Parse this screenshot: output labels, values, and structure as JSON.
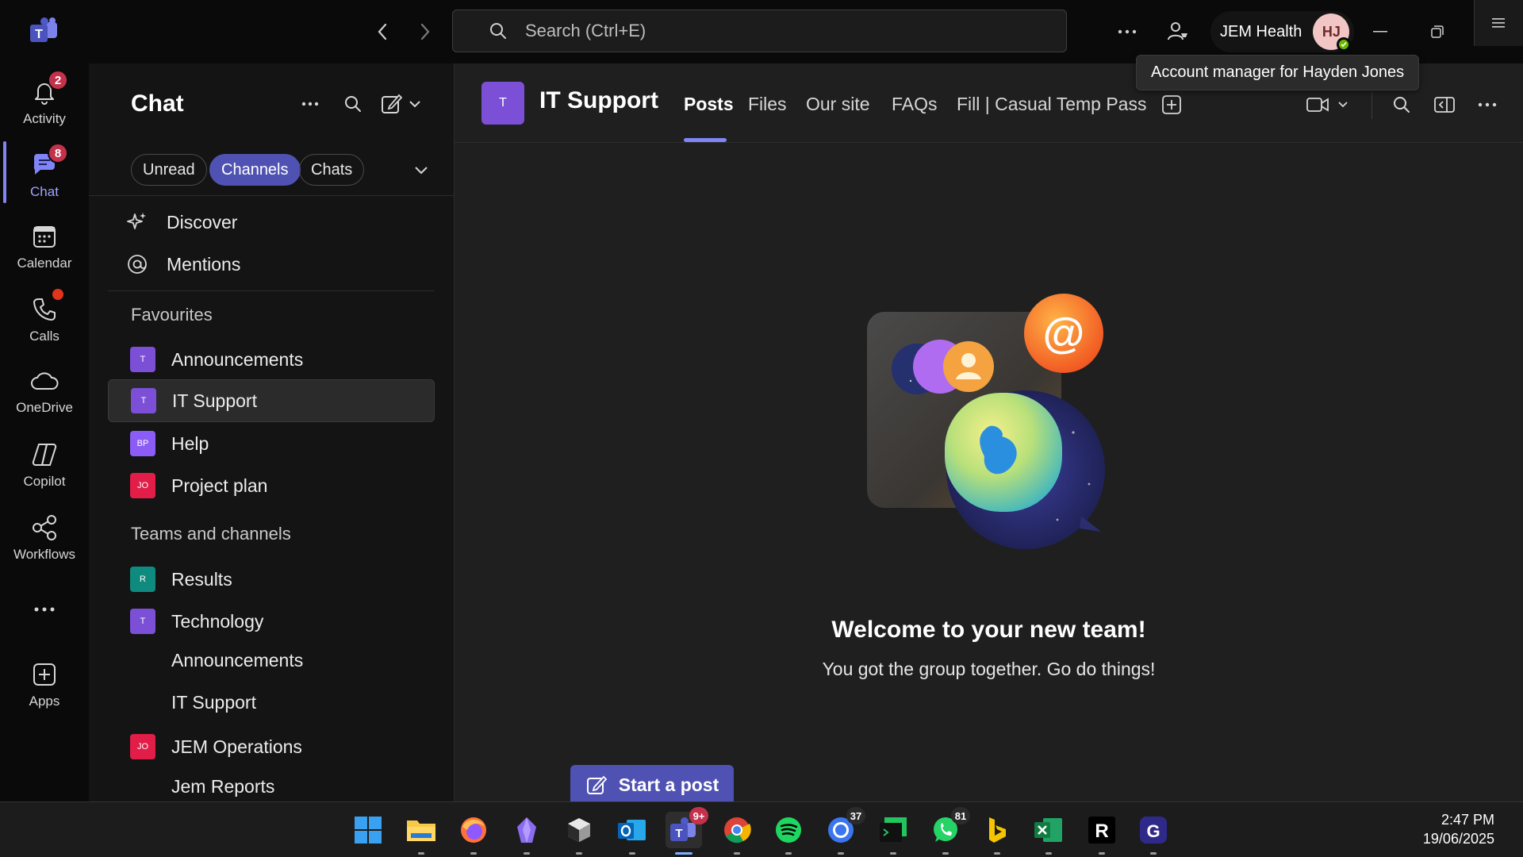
{
  "titlebar": {
    "search_placeholder": "Search (Ctrl+E)",
    "org_name": "JEM Health",
    "avatar_initials": "HJ",
    "tooltip": "Account manager for Hayden Jones"
  },
  "rail": {
    "items": [
      {
        "label": "Activity",
        "badge": "2"
      },
      {
        "label": "Chat",
        "badge": "8"
      },
      {
        "label": "Calendar"
      },
      {
        "label": "Calls"
      },
      {
        "label": "OneDrive"
      },
      {
        "label": "Copilot"
      },
      {
        "label": "Workflows"
      },
      {
        "label": "Apps"
      }
    ]
  },
  "chat": {
    "title": "Chat",
    "filters": [
      "Unread",
      "Channels",
      "Chats"
    ],
    "active_filter": "Channels",
    "nav": [
      "Discover",
      "Mentions"
    ],
    "favourites_label": "Favourites",
    "favourites": [
      {
        "tile": "T",
        "label": "Announcements",
        "color": "#7b4fd6"
      },
      {
        "tile": "T",
        "label": "IT Support",
        "color": "#7b4fd6"
      },
      {
        "tile": "BP",
        "label": "Help",
        "color": "#8b5cf6"
      },
      {
        "tile": "JO",
        "label": "Project plan",
        "color": "#e11d48"
      }
    ],
    "teams_label": "Teams and channels",
    "teams": [
      {
        "tile": "R",
        "label": "Results",
        "color": "#0f8a7e"
      },
      {
        "tile": "T",
        "label": "Technology",
        "color": "#7b4fd6"
      },
      {
        "label": "Announcements"
      },
      {
        "label": "IT Support"
      },
      {
        "tile": "JO",
        "label": "JEM Operations",
        "color": "#e11d48"
      },
      {
        "label": "Jem Reports"
      }
    ]
  },
  "main": {
    "team_tile": "T",
    "team_name": "IT Support",
    "tabs": [
      "Posts",
      "Files",
      "Our site",
      "FAQs",
      "Fill | Casual Temp Pass"
    ],
    "active_tab": "Posts",
    "welcome_title": "Welcome to your new team!",
    "welcome_sub": "You got the group together. Go do things!",
    "start_post": "Start a post"
  },
  "taskbar": {
    "apps": [
      {
        "name": "windows-start"
      },
      {
        "name": "file-explorer"
      },
      {
        "name": "firefox"
      },
      {
        "name": "obsidian"
      },
      {
        "name": "app-cube"
      },
      {
        "name": "outlook"
      },
      {
        "name": "teams",
        "badge": "9+"
      },
      {
        "name": "chrome"
      },
      {
        "name": "spotify"
      },
      {
        "name": "signal",
        "badge": "37"
      },
      {
        "name": "terminal"
      },
      {
        "name": "whatsapp",
        "badge": "81"
      },
      {
        "name": "bing"
      },
      {
        "name": "excel"
      },
      {
        "name": "r-app"
      },
      {
        "name": "g-app"
      }
    ],
    "time": "2:47 PM",
    "date": "19/06/2025"
  },
  "colors": {
    "accent": "#7f85f5",
    "pill_active": "#4f52b2",
    "badge": "#c4314b"
  }
}
